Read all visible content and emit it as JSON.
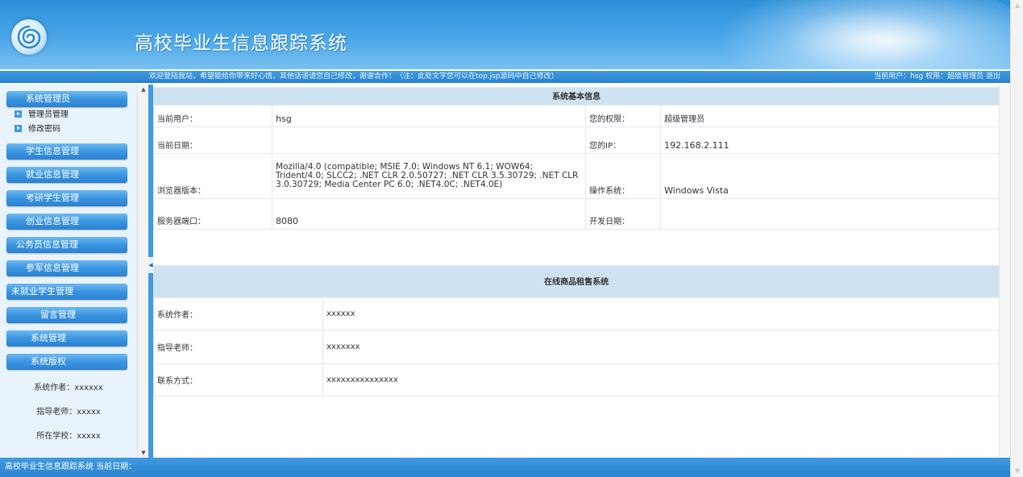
{
  "header": {
    "title": "高校毕业生信息跟踪系统"
  },
  "topbar": {
    "welcome": "欢迎登陆我站，希望能给你带来好心情，其他话语请您自己修改，谢谢合作！（注：此处文字您可以在top.jsp源码中自己修改）",
    "user_info": "当前用户：hsg 权限：超级管理员 退出"
  },
  "sidebar": {
    "admin_group": {
      "label": "系统管理员",
      "items": [
        {
          "label": "管理员管理"
        },
        {
          "label": "修改密码"
        }
      ]
    },
    "menu": [
      {
        "label": "学生信息管理"
      },
      {
        "label": "就业信息管理"
      },
      {
        "label": "考研学生管理"
      },
      {
        "label": "创业信息管理"
      },
      {
        "label": "公务员信息管理"
      },
      {
        "label": "参军信息管理"
      },
      {
        "label": "未就业学生管理"
      },
      {
        "label": "留言管理"
      },
      {
        "label": "系统管理"
      },
      {
        "label": "系统版权"
      }
    ],
    "credits": {
      "author": "系统作者：xxxxxx",
      "teacher": "指导老师：xxxxx",
      "school": "所在学校：xxxxx"
    }
  },
  "basic_info": {
    "title": "系统基本信息",
    "current_user_label": "当前用户：",
    "current_user": "hsg",
    "permission_label": "您的权限：",
    "permission": "超级管理员",
    "current_date_label": "当前日期：",
    "current_date": "",
    "ip_label": "您的IP：",
    "ip": "192.168.2.111",
    "browser_label": "浏览器版本：",
    "browser": "Mozilla/4.0 (compatible; MSIE 7.0; Windows NT 6.1; WOW64; Trident/4.0; SLCC2; .NET CLR 2.0.50727; .NET CLR 3.5.30729; .NET CLR 3.0.30729; Media Center PC 6.0; .NET4.0C; .NET4.0E)",
    "os_label": "操作系统：",
    "os": "Windows Vista",
    "port_label": "服务器端口：",
    "port": "8080",
    "dev_date_label": "开发日期：",
    "dev_date": ""
  },
  "system_info": {
    "title": "在线商品租售系统",
    "author_label": "系统作者：",
    "author": "xxxxxx",
    "teacher_label": "指导老师：",
    "teacher": "xxxxxxx",
    "contact_label": "联系方式：",
    "contact": "xxxxxxxxxxxxxxx"
  },
  "footer": {
    "text": "高校毕业生信息跟踪系统 当前日期："
  },
  "colors": {
    "header_blue": "#3a99e2",
    "nav_button": "#3b95e0",
    "sidebar_bg": "#e9f3fc",
    "table_header": "#cfe2f1"
  }
}
